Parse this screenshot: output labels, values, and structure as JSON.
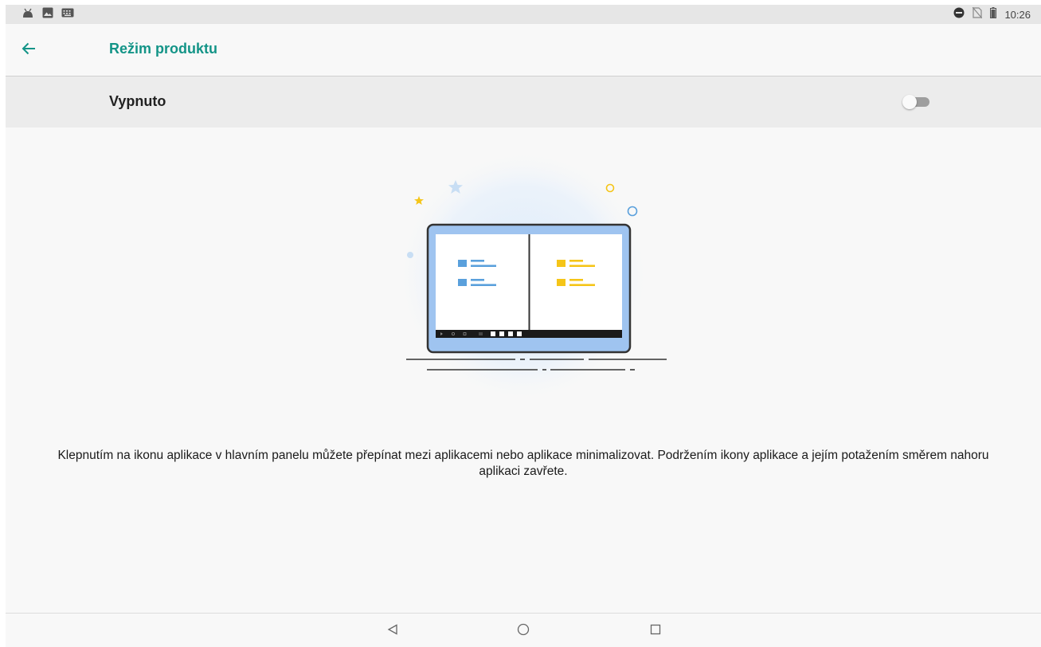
{
  "status_bar": {
    "time": "10:26",
    "left_icons": [
      "android-debug-icon",
      "image-icon",
      "keyboard-icon"
    ],
    "right_icons": [
      "do-not-disturb-icon",
      "no-sim-icon",
      "battery-icon"
    ]
  },
  "app_bar": {
    "back_icon": "arrow-left-icon",
    "title": "Režim produktu",
    "title_color": "#139487"
  },
  "switch_row": {
    "label": "Vypnuto",
    "toggle_on": false
  },
  "illustration": {
    "icon": "taskbar-illustration",
    "accent_blue": "#5aa0dc",
    "accent_yellow": "#f5c518"
  },
  "description": "Klepnutím na ikonu aplikace v hlavním panelu můžete přepínat mezi aplikacemi nebo aplikace minimalizovat. Podržením ikony aplikace a jejím potažením směrem nahoru aplikaci zavřete.",
  "nav_bar": {
    "buttons": [
      "back-triangle-icon",
      "home-circle-icon",
      "recents-square-icon"
    ]
  }
}
